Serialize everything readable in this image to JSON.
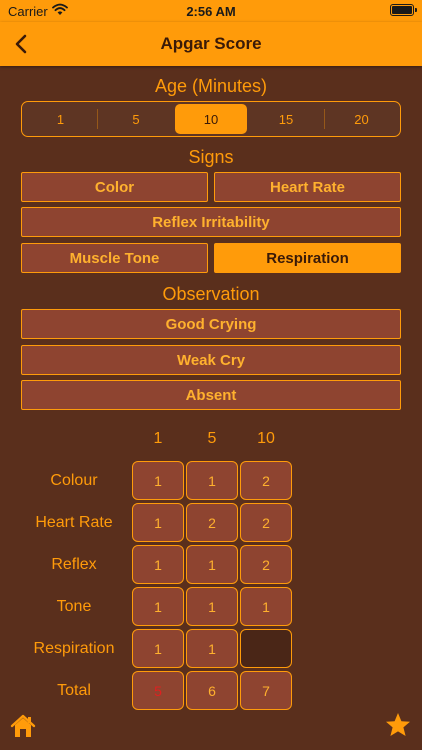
{
  "status": {
    "carrier": "Carrier",
    "time": "2:56 AM"
  },
  "nav": {
    "title": "Apgar Score",
    "back_icon": "chevron-left-icon"
  },
  "age": {
    "title": "Age  (Minutes)",
    "options": [
      "1",
      "5",
      "10",
      "15",
      "20"
    ],
    "selected": "10"
  },
  "signs": {
    "title": "Signs",
    "items": [
      "Color",
      "Heart Rate",
      "Reflex Irritability",
      "Muscle Tone",
      "Respiration"
    ],
    "selected": "Respiration"
  },
  "observation": {
    "title": "Observation",
    "items": [
      "Good Crying",
      "Weak Cry",
      "Absent"
    ]
  },
  "table": {
    "columns": [
      "1",
      "5",
      "10"
    ],
    "rows": [
      {
        "label": "Colour",
        "values": [
          "1",
          "1",
          "2"
        ]
      },
      {
        "label": "Heart Rate",
        "values": [
          "1",
          "2",
          "2"
        ]
      },
      {
        "label": "Reflex",
        "values": [
          "1",
          "1",
          "2"
        ]
      },
      {
        "label": "Tone",
        "values": [
          "1",
          "1",
          "1"
        ]
      },
      {
        "label": "Respiration",
        "values": [
          "1",
          "1",
          ""
        ]
      },
      {
        "label": "Total",
        "values": [
          "5",
          "6",
          "7"
        ]
      }
    ]
  },
  "toolbar": {
    "home_icon": "home-icon",
    "favorite_icon": "star-icon"
  },
  "colors": {
    "accent": "#ff9b0a",
    "background": "#5a2f1c",
    "button": "#8e4430",
    "low_total": "#e02020"
  }
}
